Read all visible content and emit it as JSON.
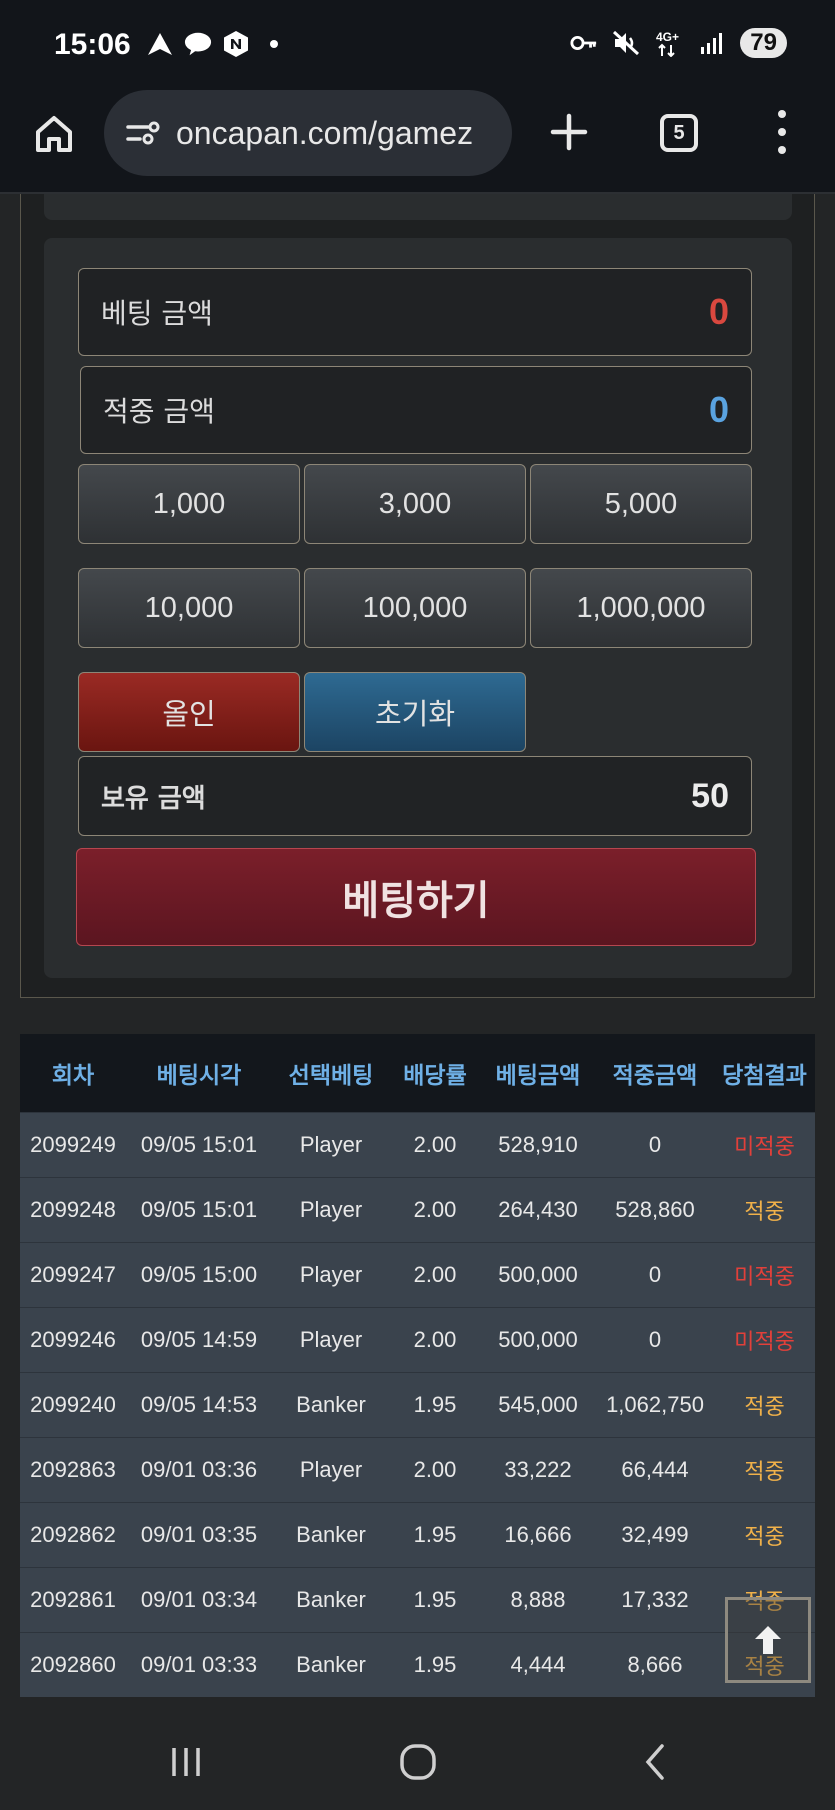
{
  "status_bar": {
    "time": "15:06",
    "battery": "79",
    "icons_left": [
      "navigation-icon",
      "talk-icon",
      "naver-icon",
      "dot-icon"
    ],
    "icons_right": [
      "key-icon",
      "mute-icon",
      "network-4g-icon",
      "signal-icon"
    ],
    "network_label": "4G+"
  },
  "browser": {
    "url": "oncapan.com/gamez",
    "tab_count": "5"
  },
  "bet_panel": {
    "bet_amount_label": "베팅 금액",
    "bet_amount_value": "0",
    "win_amount_label": "적중 금액",
    "win_amount_value": "0",
    "amount_buttons": [
      "1,000",
      "3,000",
      "5,000",
      "10,000",
      "100,000",
      "1,000,000"
    ],
    "allin_label": "올인",
    "reset_label": "초기화",
    "balance_label": "보유 금액",
    "balance_value": "50",
    "submit_label": "베팅하기",
    "colors": {
      "bet_value": "#d9483f",
      "win_value": "#5aa3e0",
      "miss": "#e2403a",
      "hit": "#f0b14a"
    }
  },
  "history": {
    "headers": [
      "회차",
      "베팅시각",
      "선택베팅",
      "배당률",
      "베팅금액",
      "적중금액",
      "당첨결과"
    ],
    "rows": [
      [
        "2099249",
        "09/05 15:01",
        "Player",
        "2.00",
        "528,910",
        "0",
        "미적중"
      ],
      [
        "2099248",
        "09/05 15:01",
        "Player",
        "2.00",
        "264,430",
        "528,860",
        "적중"
      ],
      [
        "2099247",
        "09/05 15:00",
        "Player",
        "2.00",
        "500,000",
        "0",
        "미적중"
      ],
      [
        "2099246",
        "09/05 14:59",
        "Player",
        "2.00",
        "500,000",
        "0",
        "미적중"
      ],
      [
        "2099240",
        "09/05 14:53",
        "Banker",
        "1.95",
        "545,000",
        "1,062,750",
        "적중"
      ],
      [
        "2092863",
        "09/01 03:36",
        "Player",
        "2.00",
        "33,222",
        "66,444",
        "적중"
      ],
      [
        "2092862",
        "09/01 03:35",
        "Banker",
        "1.95",
        "16,666",
        "32,499",
        "적중"
      ],
      [
        "2092861",
        "09/01 03:34",
        "Banker",
        "1.95",
        "8,888",
        "17,332",
        "적중"
      ],
      [
        "2092860",
        "09/01 03:33",
        "Banker",
        "1.95",
        "4,444",
        "8,666",
        "적중"
      ]
    ]
  },
  "nav": {
    "buttons": [
      "recents-icon",
      "home-icon",
      "back-icon"
    ]
  }
}
